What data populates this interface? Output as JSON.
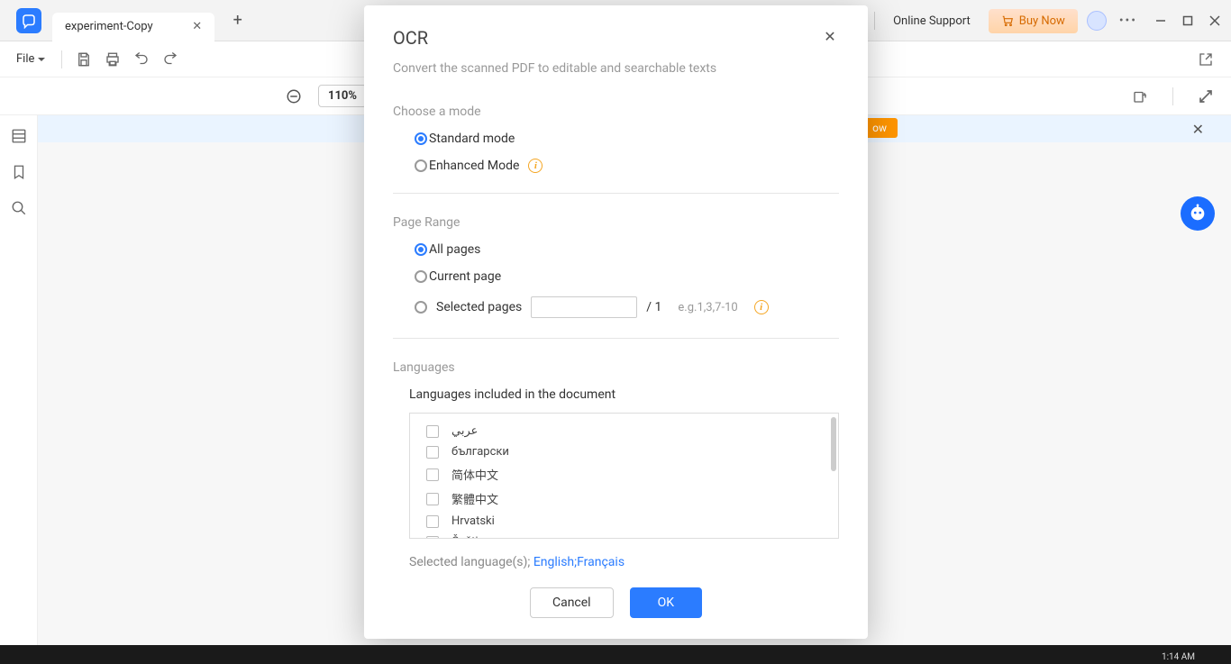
{
  "titlebar": {
    "tab_name": "experiment-Copy",
    "online_support": "Online Support",
    "buy_now": "Buy Now"
  },
  "toolbar": {
    "file": "File"
  },
  "zoom": {
    "value": "110%"
  },
  "banner": {
    "action": "ow"
  },
  "modal": {
    "title": "OCR",
    "subtitle": "Convert the scanned PDF to editable and searchable texts",
    "mode_label": "Choose a mode",
    "mode_standard": "Standard mode",
    "mode_enhanced": "Enhanced Mode",
    "range_label": "Page Range",
    "range_all": "All pages",
    "range_current": "Current page",
    "range_selected": "Selected pages",
    "page_total": "/ 1",
    "page_hint": "e.g.1,3,7-10",
    "lang_label": "Languages",
    "lang_sub": "Languages included in the document",
    "langs": [
      "عربي",
      "български",
      "简体中文",
      "繁體中文",
      "Hrvatski",
      "Čeština"
    ],
    "selected_prefix": "Selected language(s);",
    "selected_langs": "English;Français",
    "cancel": "Cancel",
    "ok": "OK"
  },
  "taskbar": {
    "time": "1:14 AM"
  }
}
